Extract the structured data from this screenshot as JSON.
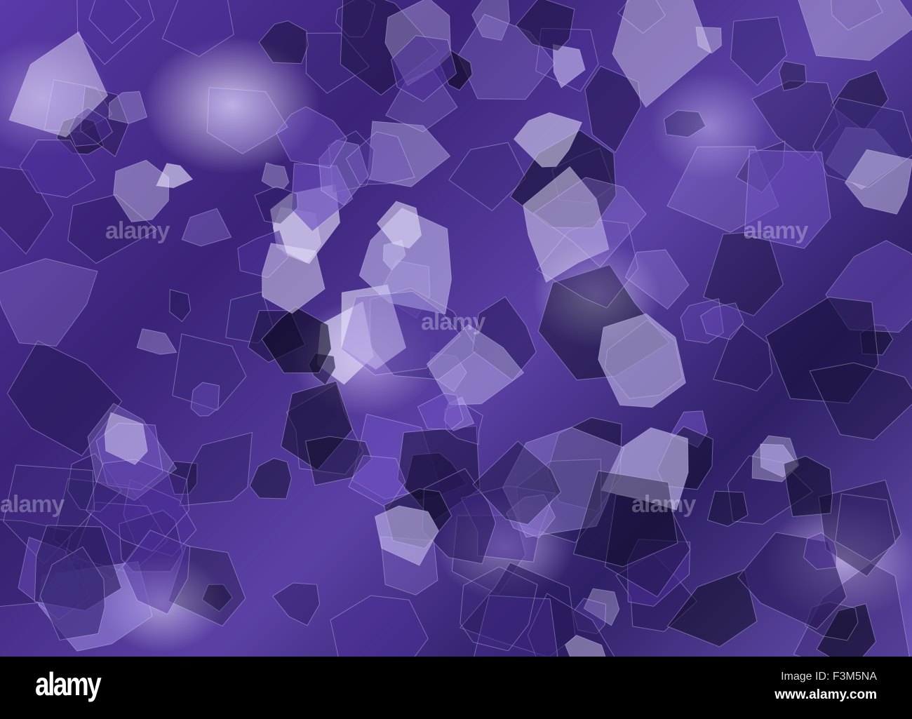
{
  "photo": {
    "subject": "amethyst crystals",
    "watermark": "alamy"
  },
  "footer": {
    "logo": "alamy",
    "image_id": "Image ID: F3M5NA",
    "url": "www.alamy.com"
  },
  "colors": {
    "deep": "#2f1f66",
    "mid": "#5a3aa8",
    "light": "#d8cff5"
  }
}
